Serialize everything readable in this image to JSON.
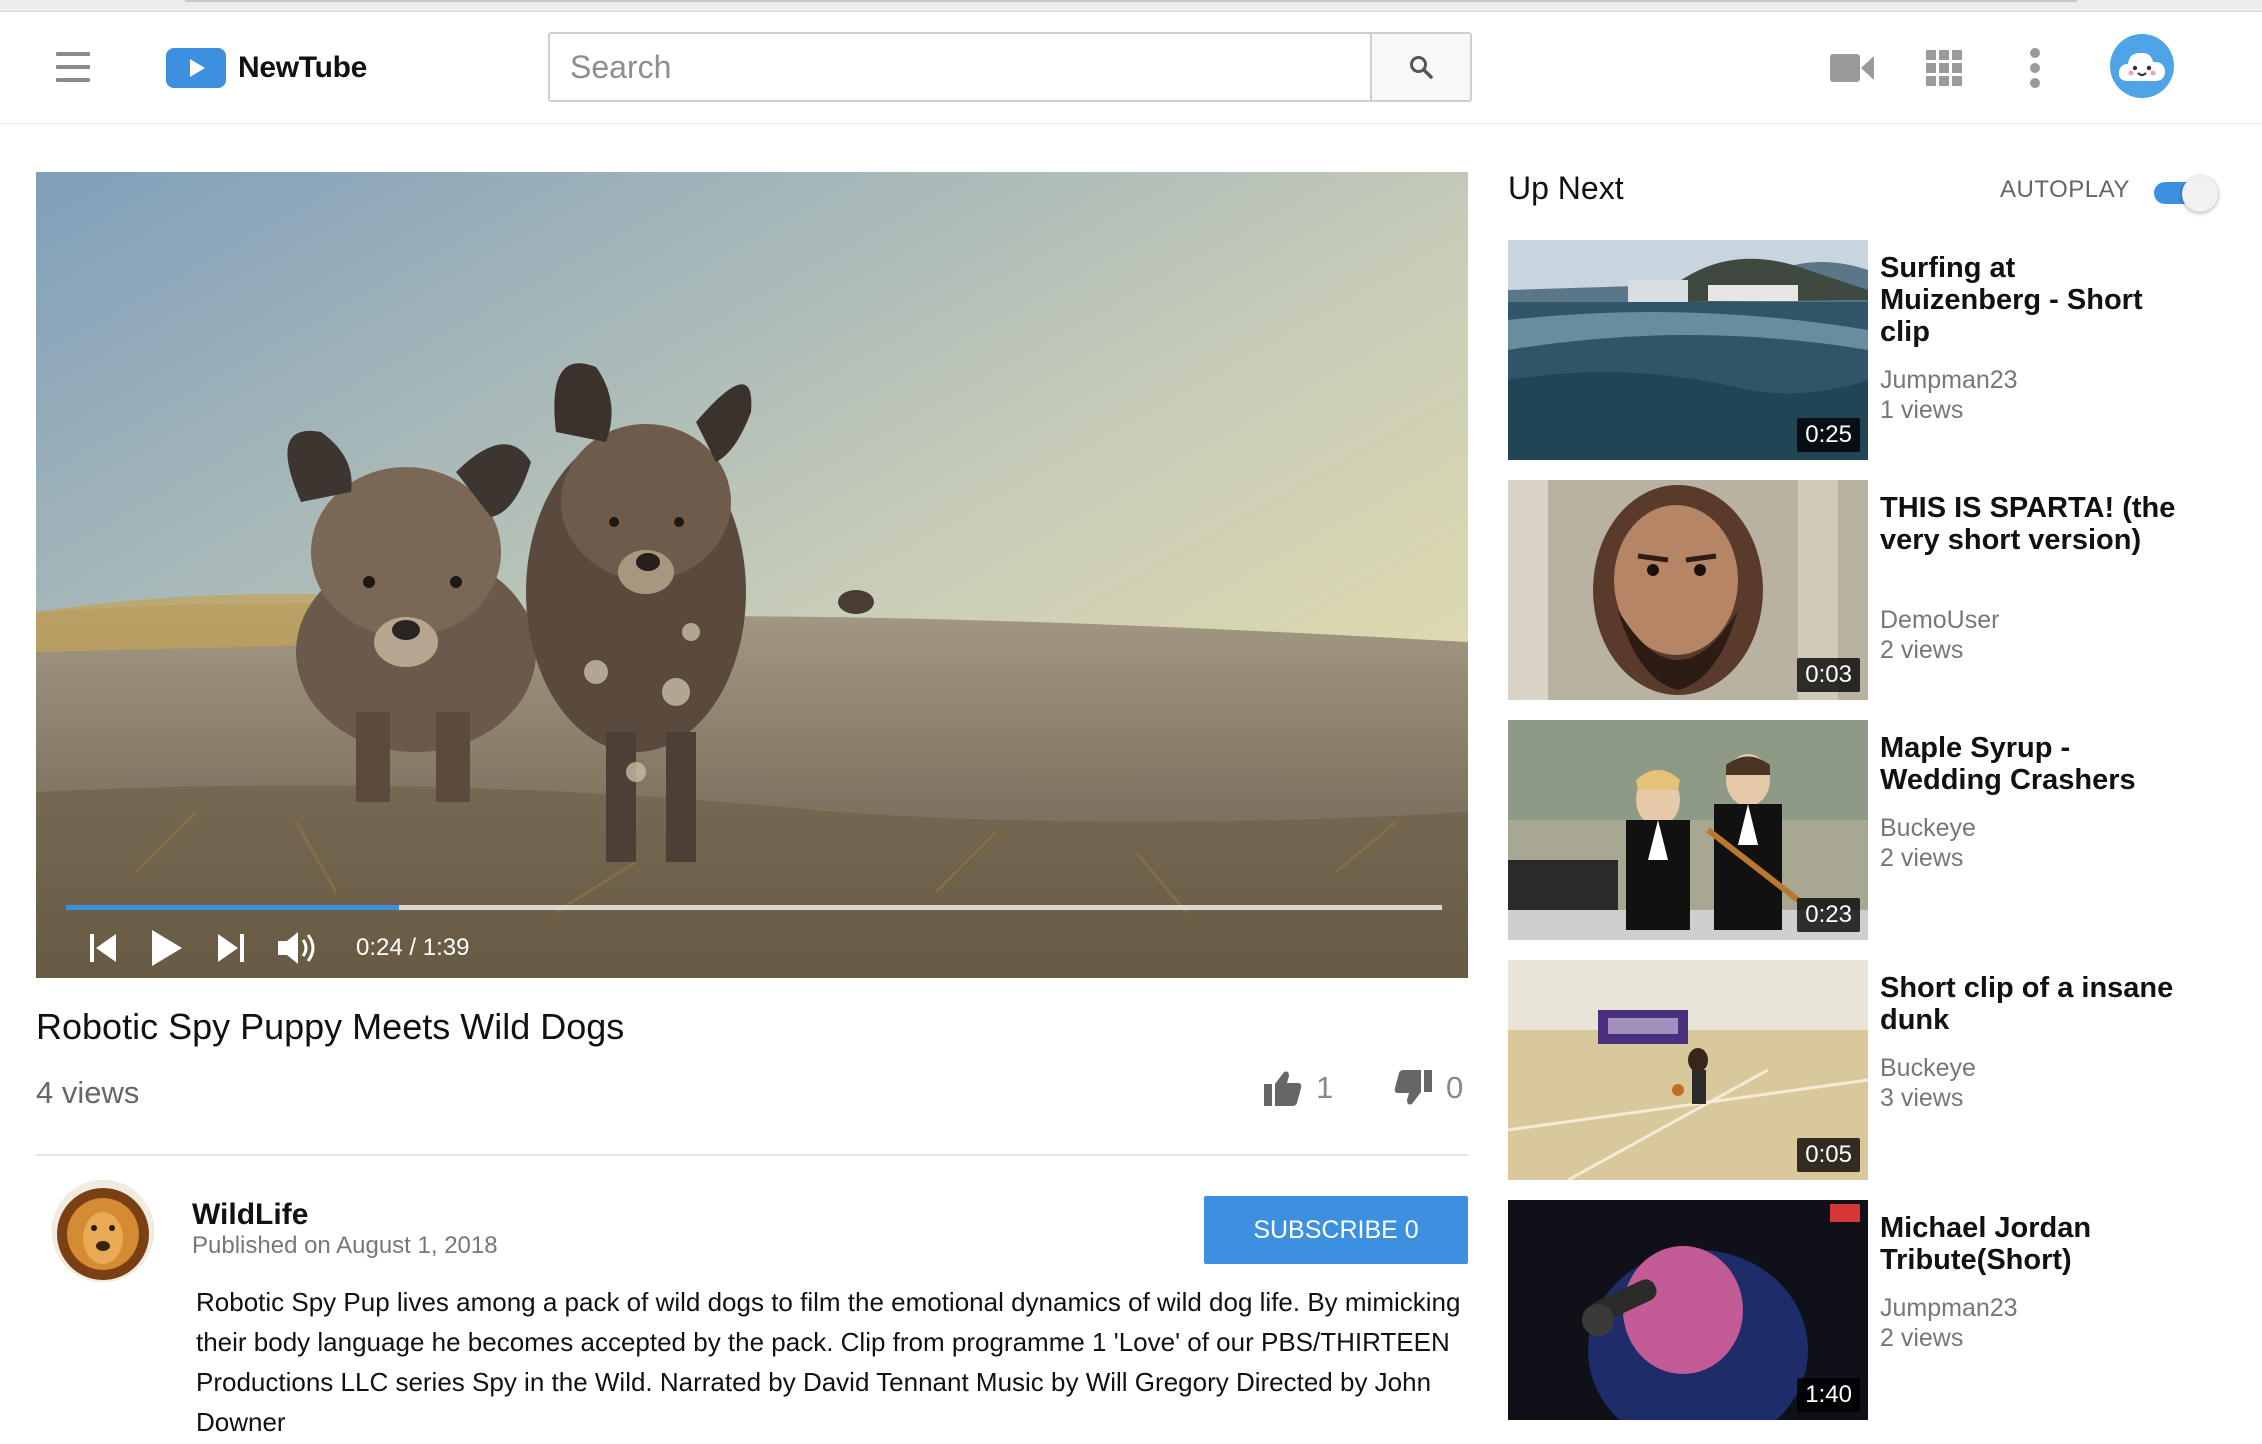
{
  "app": {
    "name": "NewTube"
  },
  "search": {
    "placeholder": "Search",
    "value": ""
  },
  "player": {
    "current_time": "0:24",
    "duration": "1:39",
    "time_display": "0:24 / 1:39",
    "progress_fraction": 0.242
  },
  "video": {
    "title": "Robotic Spy Puppy Meets Wild Dogs",
    "views": "4 views",
    "likes": "1",
    "dislikes": "0"
  },
  "channel": {
    "name": "WildLife",
    "published": "Published on August 1, 2018",
    "subscribe_label": "SUBSCRIBE 0"
  },
  "description": "Robotic Spy Pup lives among a pack of wild dogs to film the emotional dynamics of wild dog life. By mimicking their body language he becomes accepted by the pack.  Clip from programme 1 'Love' of our PBS/THIRTEEN Productions LLC series Spy in the Wild.  Narrated by David Tennant  Music by Will Gregory  Directed by John Downer",
  "up_next": {
    "title": "Up Next",
    "autoplay_label": "AUTOPLAY",
    "autoplay_on": true,
    "items": [
      {
        "title": "Surfing at Muizenberg - Short clip",
        "channel": "Jumpman23",
        "views": "1 views",
        "duration": "0:25"
      },
      {
        "title": "THIS IS SPARTA! (the very short version)",
        "channel": "DemoUser",
        "views": "2 views",
        "duration": "0:03"
      },
      {
        "title": "Maple Syrup - Wedding Crashers",
        "channel": "Buckeye",
        "views": "2 views",
        "duration": "0:23"
      },
      {
        "title": "Short clip of a insane dunk",
        "channel": "Buckeye",
        "views": "3 views",
        "duration": "0:05"
      },
      {
        "title": "Michael Jordan Tribute(Short)",
        "channel": "Jumpman23",
        "views": "2 views",
        "duration": "1:40"
      }
    ]
  },
  "colors": {
    "accent": "#3d8fe0",
    "avatar_bg": "#4ea4e6"
  },
  "icons": [
    "menu-icon",
    "play-logo-icon",
    "search-icon",
    "video-camera-icon",
    "apps-grid-icon",
    "more-vert-icon",
    "cloud-avatar-icon",
    "skip-previous-icon",
    "play-icon",
    "skip-next-icon",
    "volume-icon",
    "thumbs-up-icon",
    "thumbs-down-icon"
  ]
}
